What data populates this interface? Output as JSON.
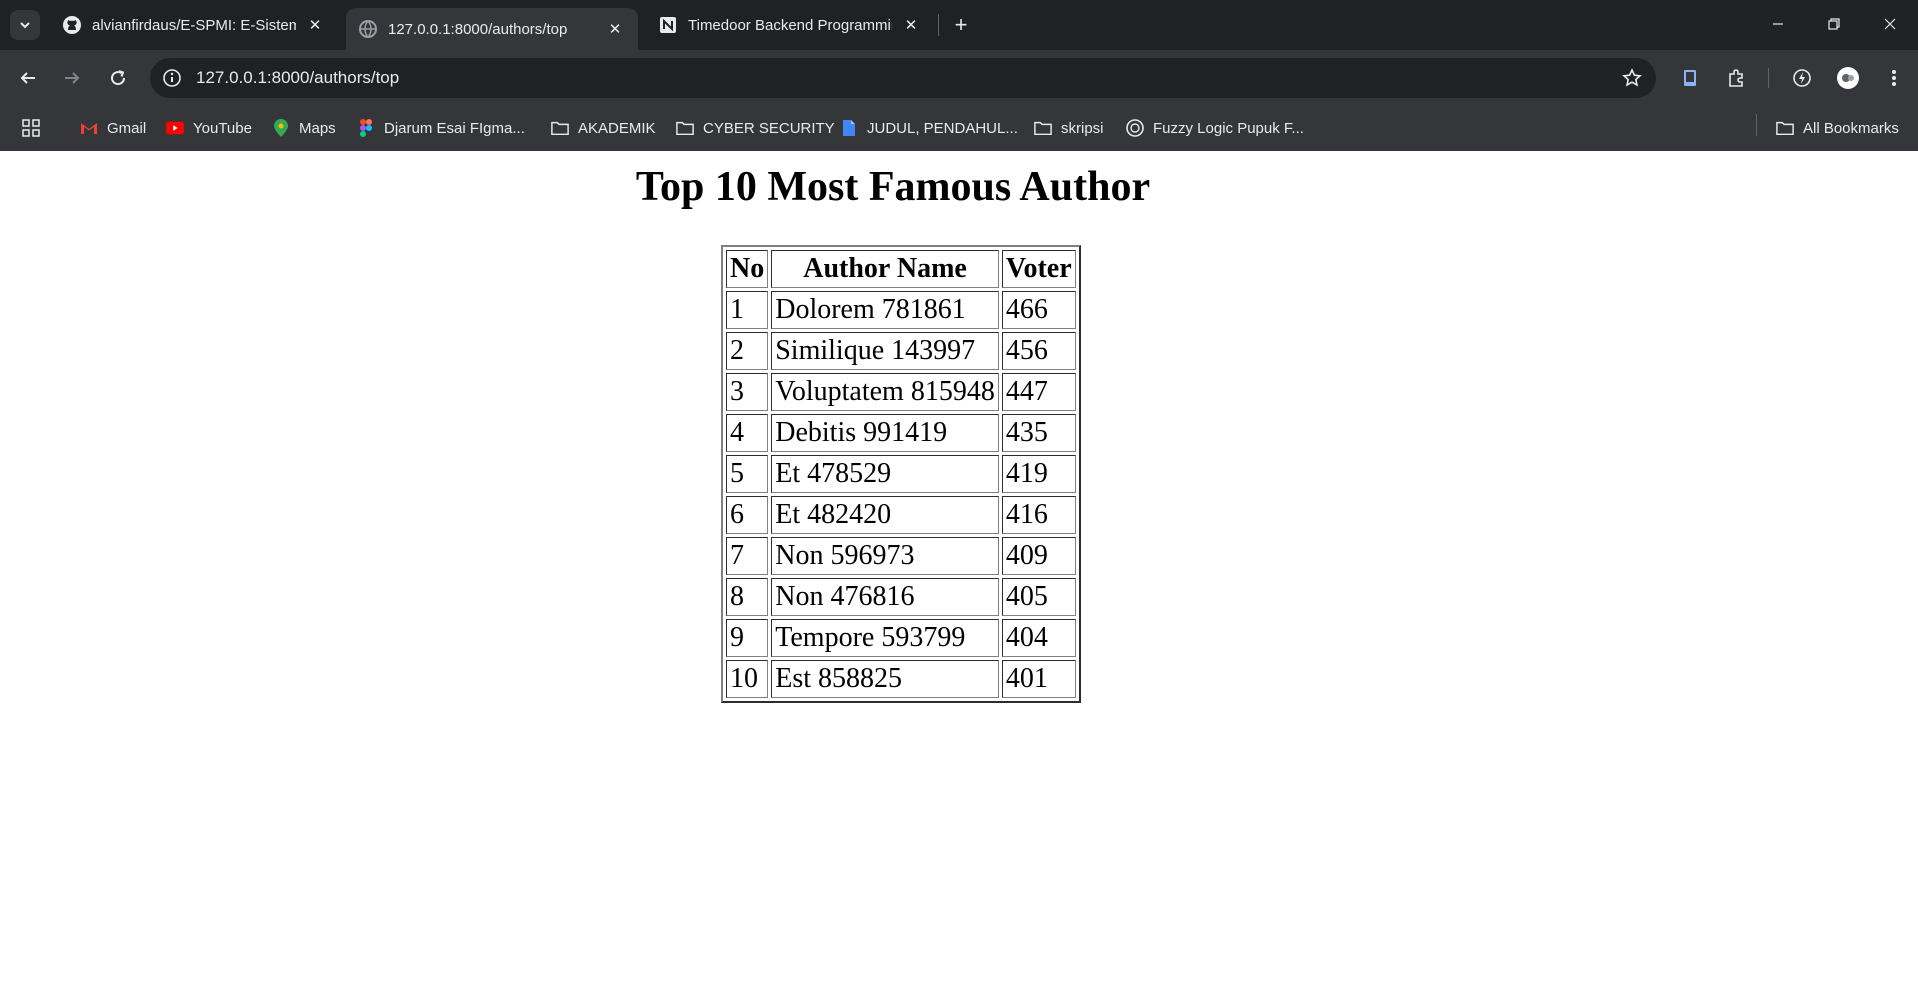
{
  "tabs": [
    {
      "title": "alvianfirdaus/E-SPMI: E-Sistem P",
      "icon": "github-icon",
      "active": false
    },
    {
      "title": "127.0.0.1:8000/authors/top",
      "icon": "globe-icon",
      "active": true
    },
    {
      "title": "Timedoor Backend Programming",
      "icon": "notion-icon",
      "active": false
    }
  ],
  "address_bar": {
    "url": "127.0.0.1:8000/authors/top"
  },
  "bookmarks": [
    {
      "label": "Gmail",
      "icon": "gmail-icon"
    },
    {
      "label": "YouTube",
      "icon": "youtube-icon"
    },
    {
      "label": "Maps",
      "icon": "maps-icon"
    },
    {
      "label": "Djarum Esai FIgma...",
      "icon": "figma-icon"
    },
    {
      "label": "AKADEMIK",
      "icon": "folder-icon"
    },
    {
      "label": "CYBER SECURITY",
      "icon": "folder-icon"
    },
    {
      "label": "JUDUL, PENDAHUL...",
      "icon": "doc-icon"
    },
    {
      "label": "skripsi",
      "icon": "folder-icon"
    },
    {
      "label": "Fuzzy Logic Pupuk F...",
      "icon": "chatgpt-icon"
    }
  ],
  "all_bookmarks_label": "All Bookmarks",
  "page": {
    "heading": "Top 10 Most Famous Author",
    "columns": [
      "No",
      "Author Name",
      "Voter"
    ],
    "rows": [
      [
        "1",
        "Dolorem 781861",
        "466"
      ],
      [
        "2",
        "Similique 143997",
        "456"
      ],
      [
        "3",
        "Voluptatem 815948",
        "447"
      ],
      [
        "4",
        "Debitis 991419",
        "435"
      ],
      [
        "5",
        "Et 478529",
        "419"
      ],
      [
        "6",
        "Et 482420",
        "416"
      ],
      [
        "7",
        "Non 596973",
        "409"
      ],
      [
        "8",
        "Non 476816",
        "405"
      ],
      [
        "9",
        "Tempore 593799",
        "404"
      ],
      [
        "10",
        "Est 858825",
        "401"
      ]
    ]
  }
}
